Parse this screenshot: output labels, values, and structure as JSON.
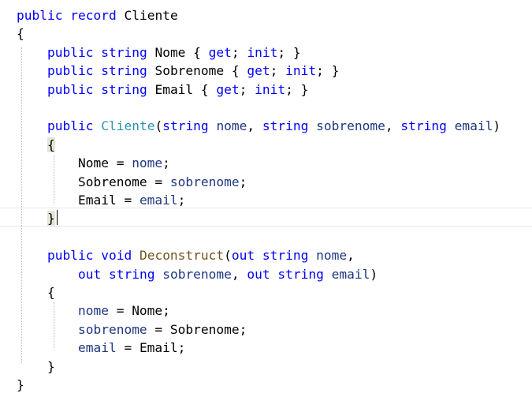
{
  "editor": {
    "lines": [
      [
        {
          "t": "public",
          "c": "kw"
        },
        {
          "t": " "
        },
        {
          "t": "record",
          "c": "kw"
        },
        {
          "t": " Cliente"
        }
      ],
      [
        {
          "t": "{"
        }
      ],
      [
        {
          "t": "    "
        },
        {
          "t": "public",
          "c": "kw"
        },
        {
          "t": " "
        },
        {
          "t": "string",
          "c": "kw"
        },
        {
          "t": " Nome { "
        },
        {
          "t": "get",
          "c": "kw"
        },
        {
          "t": "; "
        },
        {
          "t": "init",
          "c": "kw"
        },
        {
          "t": "; }"
        }
      ],
      [
        {
          "t": "    "
        },
        {
          "t": "public",
          "c": "kw"
        },
        {
          "t": " "
        },
        {
          "t": "string",
          "c": "kw"
        },
        {
          "t": " Sobrenome { "
        },
        {
          "t": "get",
          "c": "kw"
        },
        {
          "t": "; "
        },
        {
          "t": "init",
          "c": "kw"
        },
        {
          "t": "; }"
        }
      ],
      [
        {
          "t": "    "
        },
        {
          "t": "public",
          "c": "kw"
        },
        {
          "t": " "
        },
        {
          "t": "string",
          "c": "kw"
        },
        {
          "t": " Email { "
        },
        {
          "t": "get",
          "c": "kw"
        },
        {
          "t": "; "
        },
        {
          "t": "init",
          "c": "kw"
        },
        {
          "t": "; }"
        }
      ],
      [],
      [
        {
          "t": "    "
        },
        {
          "t": "public",
          "c": "kw"
        },
        {
          "t": " "
        },
        {
          "t": "Cliente",
          "c": "type"
        },
        {
          "t": "("
        },
        {
          "t": "string",
          "c": "kw"
        },
        {
          "t": " "
        },
        {
          "t": "nome",
          "c": "param"
        },
        {
          "t": ", "
        },
        {
          "t": "string",
          "c": "kw"
        },
        {
          "t": " "
        },
        {
          "t": "sobrenome",
          "c": "param"
        },
        {
          "t": ", "
        },
        {
          "t": "string",
          "c": "kw"
        },
        {
          "t": " "
        },
        {
          "t": "email",
          "c": "param"
        },
        {
          "t": ")"
        }
      ],
      [
        {
          "t": "    "
        },
        {
          "t": "{",
          "c": "brace-hl"
        }
      ],
      [
        {
          "t": "        Nome = "
        },
        {
          "t": "nome",
          "c": "param"
        },
        {
          "t": ";"
        }
      ],
      [
        {
          "t": "        Sobrenome = "
        },
        {
          "t": "sobrenome",
          "c": "param"
        },
        {
          "t": ";"
        }
      ],
      [
        {
          "t": "        Email = "
        },
        {
          "t": "email",
          "c": "param"
        },
        {
          "t": ";"
        }
      ],
      [
        {
          "t": "    "
        },
        {
          "t": "}",
          "c": "brace-hl"
        }
      ],
      [],
      [
        {
          "t": "    "
        },
        {
          "t": "public",
          "c": "kw"
        },
        {
          "t": " "
        },
        {
          "t": "void",
          "c": "kw"
        },
        {
          "t": " "
        },
        {
          "t": "Deconstruct",
          "c": "method"
        },
        {
          "t": "("
        },
        {
          "t": "out",
          "c": "kw"
        },
        {
          "t": " "
        },
        {
          "t": "string",
          "c": "kw"
        },
        {
          "t": " "
        },
        {
          "t": "nome",
          "c": "param"
        },
        {
          "t": ","
        }
      ],
      [
        {
          "t": "        "
        },
        {
          "t": "out",
          "c": "kw"
        },
        {
          "t": " "
        },
        {
          "t": "string",
          "c": "kw"
        },
        {
          "t": " "
        },
        {
          "t": "sobrenome",
          "c": "param"
        },
        {
          "t": ", "
        },
        {
          "t": "out",
          "c": "kw"
        },
        {
          "t": " "
        },
        {
          "t": "string",
          "c": "kw"
        },
        {
          "t": " "
        },
        {
          "t": "email",
          "c": "param"
        },
        {
          "t": ")"
        }
      ],
      [
        {
          "t": "    {"
        }
      ],
      [
        {
          "t": "        "
        },
        {
          "t": "nome",
          "c": "param"
        },
        {
          "t": " = Nome;"
        }
      ],
      [
        {
          "t": "        "
        },
        {
          "t": "sobrenome",
          "c": "param"
        },
        {
          "t": " = Sobrenome;"
        }
      ],
      [
        {
          "t": "        "
        },
        {
          "t": "email",
          "c": "param"
        },
        {
          "t": " = Email;"
        }
      ],
      [
        {
          "t": "    }"
        }
      ],
      [
        {
          "t": "}"
        }
      ]
    ]
  },
  "colors": {
    "keyword": "#0000ff",
    "type": "#2b91af",
    "method": "#74531f",
    "parameter": "#1f377f",
    "text": "#000000",
    "background": "#ffffff",
    "brace_match": "#e2e6d6"
  }
}
